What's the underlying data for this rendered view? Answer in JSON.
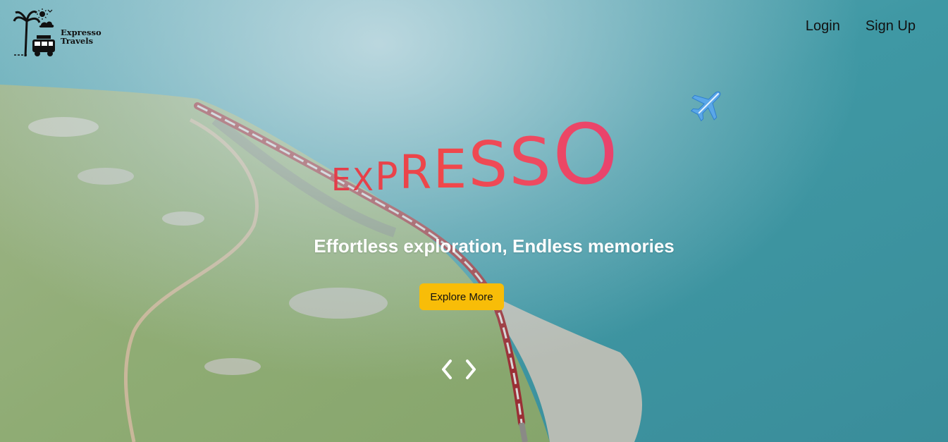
{
  "logo": {
    "line1": "Expresso",
    "line2": "Travels",
    "icon": "travel-logo-icon"
  },
  "nav": {
    "login_label": "Login",
    "signup_label": "Sign Up"
  },
  "hero": {
    "brand_letters": [
      "E",
      "X",
      "P",
      "R",
      "E",
      "S",
      "S",
      "O"
    ],
    "tagline": "Effortless exploration, Endless memories",
    "cta_label": "Explore More",
    "plane_icon": "airplane-icon",
    "prev_icon": "chevron-left-icon",
    "next_icon": "chevron-right-icon"
  },
  "colors": {
    "cta": "#f8bd08",
    "brand_red": "#ef4050",
    "nav_text": "#111111"
  }
}
